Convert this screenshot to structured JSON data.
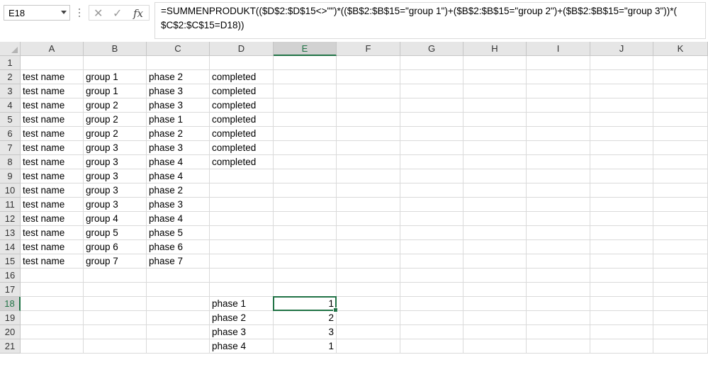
{
  "name_box": {
    "value": "E18"
  },
  "formula_bar": {
    "lines": [
      "=SUMMENPRODUKT(($D$2:$D$15<>\"\")*(($B$2:$B$15=\"group 1\")+($B$2:$B$15=\"group 2\")+($B$2:$B$15=\"group 3\"))*(",
      "$C$2:$C$15=D18))"
    ],
    "cancel_glyph": "✕",
    "enter_glyph": "✓",
    "fx_label": "fx"
  },
  "sheet": {
    "columns": [
      "A",
      "B",
      "C",
      "D",
      "E",
      "F",
      "G",
      "H",
      "I",
      "J",
      "K"
    ],
    "selected_column": "E",
    "selected_row": 18,
    "rows": [
      {
        "n": "1",
        "cells": [
          "",
          "",
          "",
          "",
          ""
        ]
      },
      {
        "n": "2",
        "cells": [
          "test name",
          "group 1",
          "phase 2",
          "completed",
          ""
        ]
      },
      {
        "n": "3",
        "cells": [
          "test name",
          "group 1",
          "phase 3",
          "completed",
          ""
        ]
      },
      {
        "n": "4",
        "cells": [
          "test name",
          "group 2",
          "phase 3",
          "completed",
          ""
        ]
      },
      {
        "n": "5",
        "cells": [
          "test name",
          "group 2",
          "phase 1",
          "completed",
          ""
        ]
      },
      {
        "n": "6",
        "cells": [
          "test name",
          "group 2",
          "phase 2",
          "completed",
          ""
        ]
      },
      {
        "n": "7",
        "cells": [
          "test name",
          "group 3",
          "phase 3",
          "completed",
          ""
        ]
      },
      {
        "n": "8",
        "cells": [
          "test name",
          "group 3",
          "phase 4",
          "completed",
          ""
        ]
      },
      {
        "n": "9",
        "cells": [
          "test name",
          "group 3",
          "phase 4",
          "",
          ""
        ]
      },
      {
        "n": "10",
        "cells": [
          "test name",
          "group 3",
          "phase 2",
          "",
          ""
        ]
      },
      {
        "n": "11",
        "cells": [
          "test name",
          "group 3",
          "phase 3",
          "",
          ""
        ]
      },
      {
        "n": "12",
        "cells": [
          "test name",
          "group 4",
          "phase 4",
          "",
          ""
        ]
      },
      {
        "n": "13",
        "cells": [
          "test name",
          "group 5",
          "phase 5",
          "",
          ""
        ]
      },
      {
        "n": "14",
        "cells": [
          "test name",
          "group 6",
          "phase 6",
          "",
          ""
        ]
      },
      {
        "n": "15",
        "cells": [
          "test name",
          "group 7",
          "phase 7",
          "",
          ""
        ]
      },
      {
        "n": "16",
        "cells": [
          "",
          "",
          "",
          "",
          ""
        ]
      },
      {
        "n": "17",
        "cells": [
          "",
          "",
          "",
          "",
          ""
        ]
      },
      {
        "n": "18",
        "cells": [
          "",
          "",
          "",
          "phase 1",
          "1"
        ]
      },
      {
        "n": "19",
        "cells": [
          "",
          "",
          "",
          "phase 2",
          "2"
        ]
      },
      {
        "n": "20",
        "cells": [
          "",
          "",
          "",
          "phase 3",
          "3"
        ]
      },
      {
        "n": "21",
        "cells": [
          "",
          "",
          "",
          "phase 4",
          "1"
        ]
      }
    ]
  },
  "colors": {
    "accent": "#217346",
    "header_bg": "#e6e6e6",
    "grid": "#dadada"
  }
}
